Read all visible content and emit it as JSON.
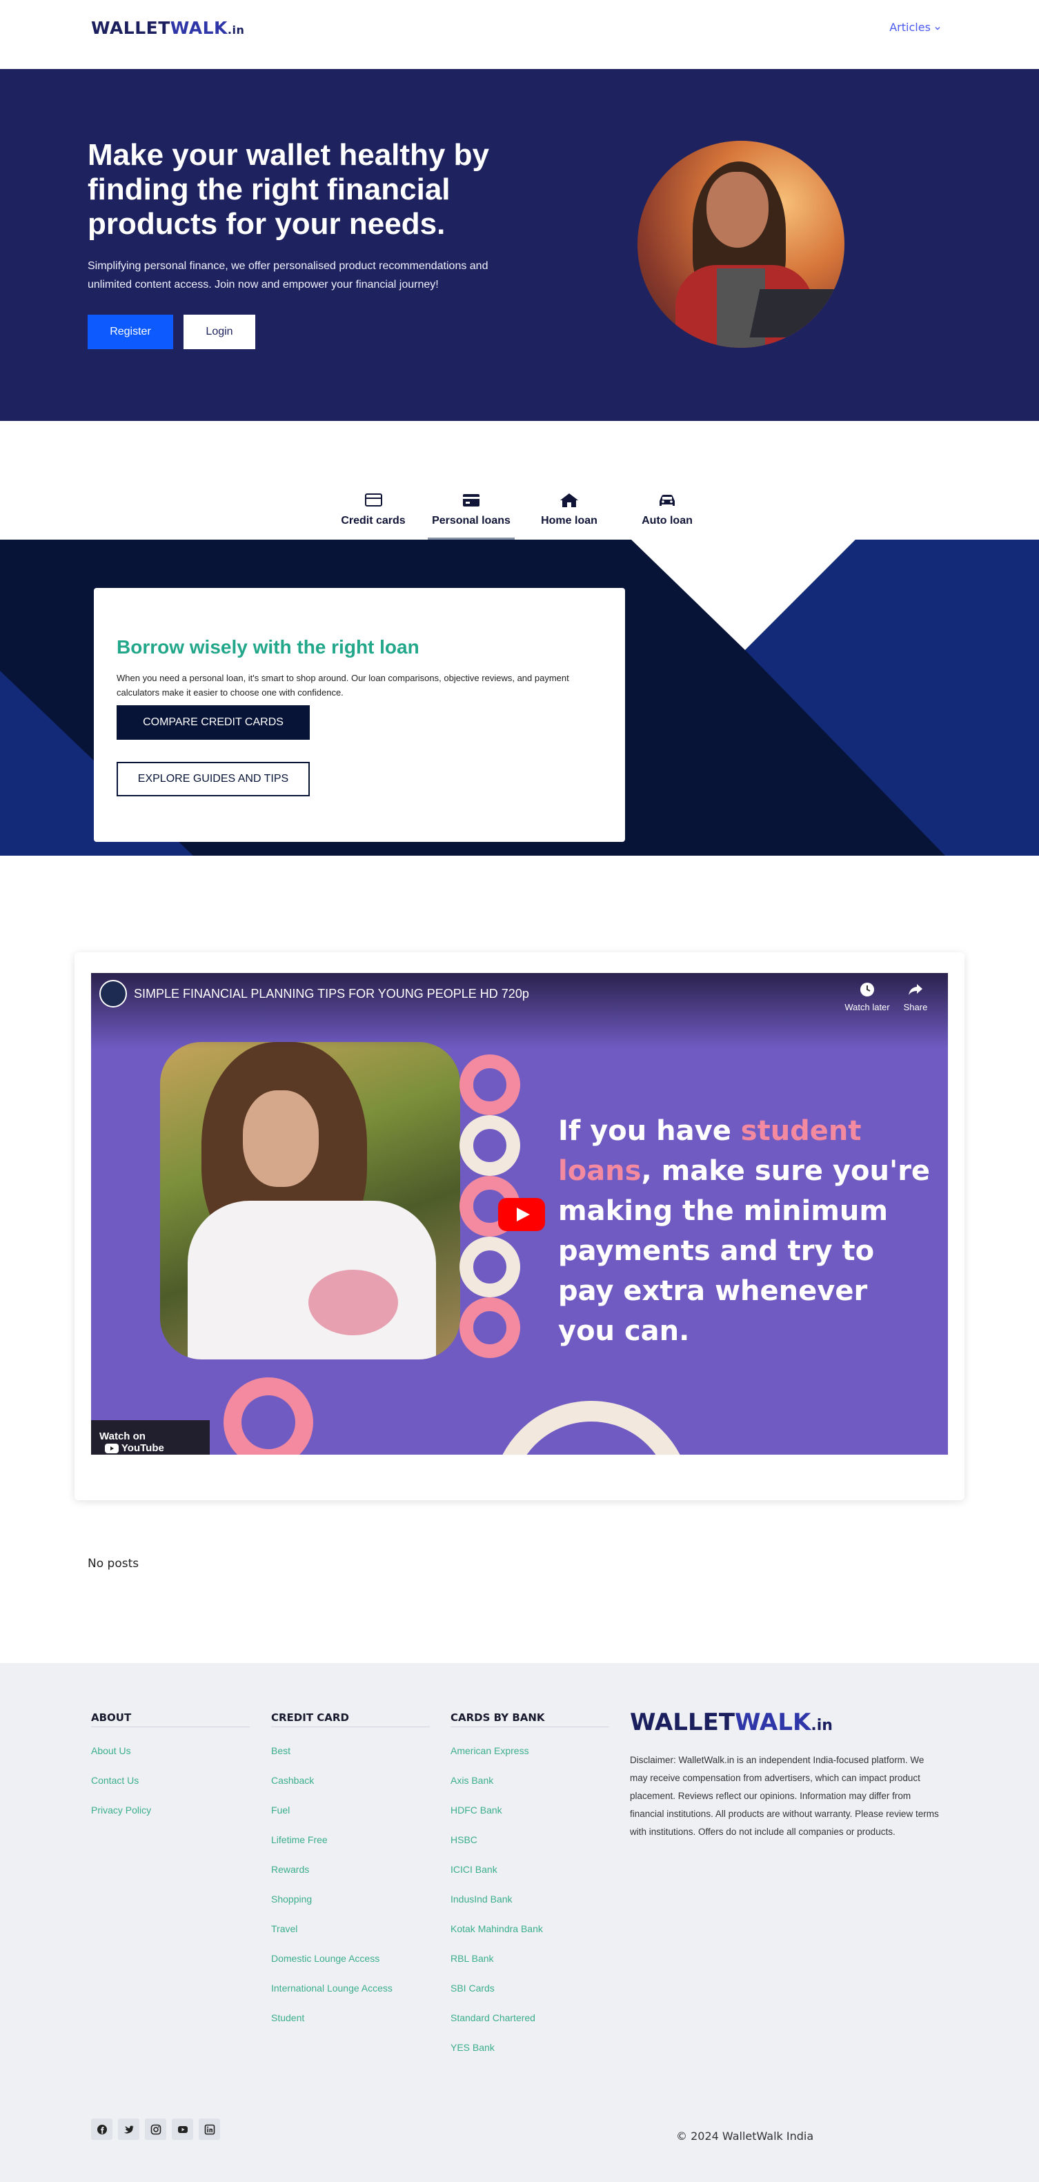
{
  "header": {
    "logo_part1": "WALLET",
    "logo_part2": "WALK",
    "logo_part3": ".in",
    "nav_articles": "Articles",
    "nav_articles_icon": "chevron-down-icon"
  },
  "hero": {
    "title": "Make your wallet healthy by finding the right financial products for your needs.",
    "subtitle": "Simplifying personal finance, we offer personalised product recommendations and unlimited content access. Join now and empower your financial journey!",
    "register_label": "Register",
    "login_label": "Login",
    "background_color": "#1e2360",
    "register_color": "#0d5bff"
  },
  "tabs": [
    {
      "label": "Credit cards",
      "icon": "credit-card-icon",
      "active": false
    },
    {
      "label": "Personal loans",
      "icon": "wallet-card-icon",
      "active": true
    },
    {
      "label": "Home loan",
      "icon": "home-icon",
      "active": false
    },
    {
      "label": "Auto loan",
      "icon": "car-icon",
      "active": false
    }
  ],
  "loans_card": {
    "title": "Borrow wisely with the right loan",
    "body": "When you need a personal loan, it's smart to shop around. Our loan comparisons, objective reviews, and payment calculators make it easier to choose one with confidence.",
    "compare_label": "COMPARE CREDIT CARDS",
    "guides_label": "EXPLORE GUIDES AND TIPS",
    "title_color": "#22a78a"
  },
  "video": {
    "title": "SIMPLE FINANCIAL PLANNING TIPS FOR YOUNG PEOPLE HD 720p",
    "watch_later": "Watch later",
    "share": "Share",
    "text_part1": "If you have ",
    "text_highlight": "student loans",
    "text_part2": ", make sure you're making the minimum payments and try to pay extra whenever you can.",
    "watch_on": "Watch on",
    "youtube": "YouTube"
  },
  "posts": {
    "empty_text": "No posts"
  },
  "footer": {
    "about": {
      "heading": "ABOUT",
      "links": [
        "About Us",
        "Contact Us",
        "Privacy Policy"
      ]
    },
    "credit_card": {
      "heading": "CREDIT CARD",
      "links": [
        "Best",
        "Cashback",
        "Fuel",
        "Lifetime Free",
        "Rewards",
        "Shopping",
        "Travel",
        "Domestic Lounge Access",
        "International Lounge Access",
        "Student"
      ]
    },
    "cards_by_bank": {
      "heading": "CARDS BY BANK",
      "links": [
        "American Express",
        "Axis Bank",
        "HDFC Bank",
        "HSBC",
        "ICICI Bank",
        "IndusInd Bank",
        "Kotak Mahindra Bank",
        "RBL Bank",
        "SBI Cards",
        "Standard Chartered",
        "YES Bank"
      ]
    },
    "logo_part1": "WALLET",
    "logo_part2": "WALK",
    "logo_part3": ".in",
    "disclaimer": "Disclaimer: WalletWalk.in is an independent India-focused platform. We may receive compensation from advertisers, which can impact product placement. Reviews reflect our opinions. Information may differ from financial institutions. All products are without warranty. Please review terms with institutions. Offers do not include all companies or products.",
    "socials": [
      "facebook-icon",
      "twitter-icon",
      "instagram-icon",
      "youtube-icon",
      "linkedin-icon"
    ],
    "copyright": "© 2024 WalletWalk India",
    "link_color": "#3bae8a"
  }
}
